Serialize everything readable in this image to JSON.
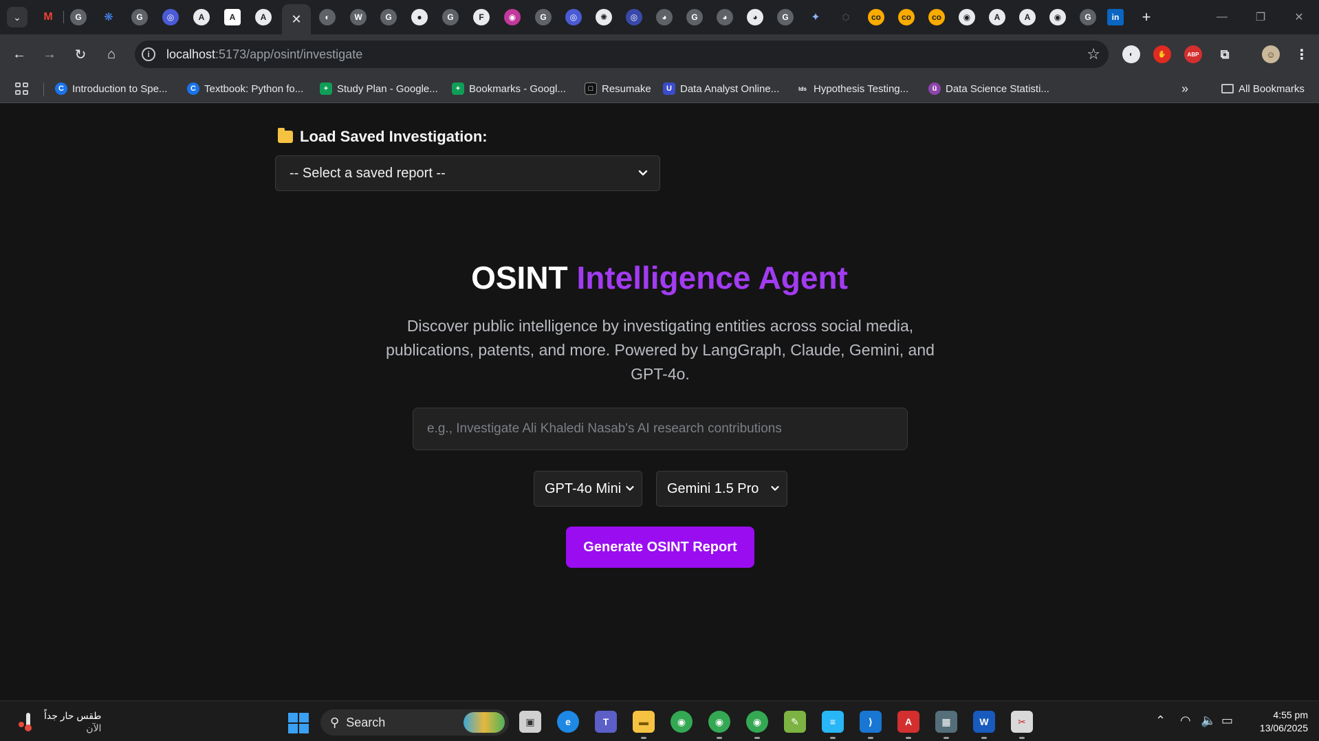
{
  "browser": {
    "tabs": [
      {
        "icon": "gmail-icon",
        "color": "#ea4335"
      },
      {
        "icon": "google-icon",
        "color": "#5f6368"
      },
      {
        "icon": "butterfly-icon",
        "color": "#4285f4"
      },
      {
        "icon": "google-icon",
        "color": "#5f6368"
      },
      {
        "icon": "circle-app-icon",
        "color": "#4b5bd6"
      },
      {
        "icon": "anthropic-icon",
        "color": "#ffffff"
      },
      {
        "icon": "anthropic-icon",
        "color": "#ffffff"
      },
      {
        "icon": "anthropic-icon",
        "color": "#ffffff"
      }
    ],
    "active_tab_close_glyph": "✕",
    "new_tab_glyph": "+",
    "url_host": "localhost",
    "url_path": ":5173/app/osint/investigate"
  },
  "bookmarks": [
    {
      "label": "Introduction to Spe...",
      "icon": "C",
      "color": "#1a73e8"
    },
    {
      "label": "Textbook: Python fo...",
      "icon": "C",
      "color": "#1a73e8"
    },
    {
      "label": "Study Plan - Google...",
      "icon": "+",
      "color": "#0f9d58"
    },
    {
      "label": "Bookmarks - Googl...",
      "icon": "+",
      "color": "#0f9d58"
    },
    {
      "label": "Resumake",
      "icon": "□",
      "color": "#111111"
    },
    {
      "label": "Data Analyst Online...",
      "icon": "U",
      "color": "#3b4cca"
    },
    {
      "label": "Hypothesis Testing...",
      "icon": "tds",
      "color": "#35363a"
    },
    {
      "label": "Data Science Statisti...",
      "icon": "ü",
      "color": "#8e44ad"
    }
  ],
  "all_bookmarks_label": "All Bookmarks",
  "page": {
    "load_label": "Load Saved Investigation:",
    "saved_select_value": "-- Select a saved report --",
    "title_part1": "OSINT ",
    "title_part2": "Intelligence Agent",
    "description": "Discover public intelligence by investigating entities across social media, publications, patents, and more. Powered by LangGraph, Claude, Gemini, and GPT-4o.",
    "query_placeholder": "e.g., Investigate Ali Khaledi Nasab's AI research contributions",
    "model_1": "GPT-4o Mini",
    "model_2": "Gemini 1.5 Pro",
    "generate_label": "Generate OSINT Report",
    "accent_color": "#a23bf2",
    "button_color": "#9a0df0"
  },
  "taskbar": {
    "weather_line1": "طقس حار جداً",
    "weather_line2": "الآن",
    "search_label": "Search",
    "time": "4:55 pm",
    "date": "13/06/2025"
  }
}
